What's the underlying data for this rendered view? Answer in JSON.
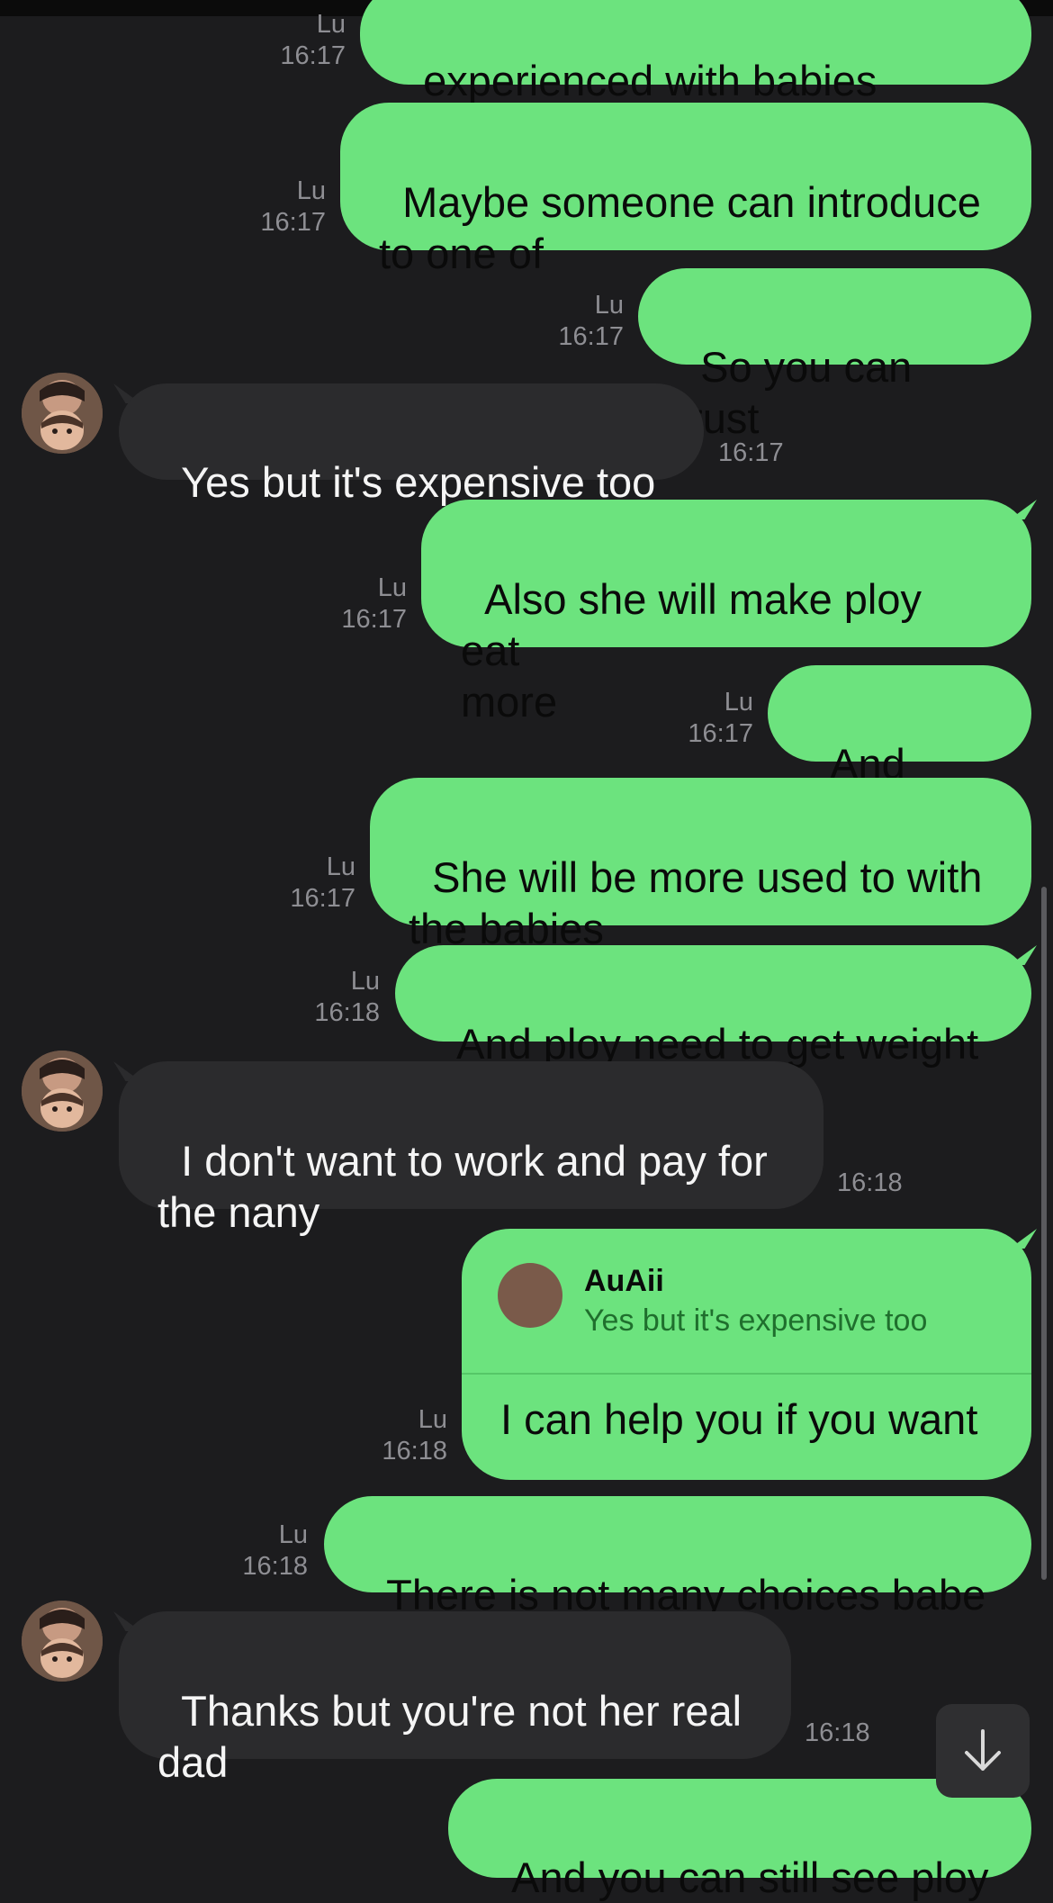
{
  "messages": [
    {
      "dir": "out",
      "sender": "Lu",
      "time": "16:17",
      "text": "experienced with babies"
    },
    {
      "dir": "out",
      "sender": "Lu",
      "time": "16:17",
      "text": "Maybe someone can introduce\nto one of"
    },
    {
      "dir": "out",
      "sender": "Lu",
      "time": "16:17",
      "text": "So you can trust"
    },
    {
      "dir": "in",
      "time": "16:17",
      "text": "Yes but it's expensive too"
    },
    {
      "dir": "out",
      "sender": "Lu",
      "time": "16:17",
      "text": "Also she will make ploy eat\nmore"
    },
    {
      "dir": "out",
      "sender": "Lu",
      "time": "16:17",
      "text": "And drink"
    },
    {
      "dir": "out",
      "sender": "Lu",
      "time": "16:17",
      "text": "She will be more used to with\nthe babies"
    },
    {
      "dir": "out",
      "sender": "Lu",
      "time": "16:18",
      "text": "And ploy need to get weight"
    },
    {
      "dir": "in",
      "time": "16:18",
      "text": "I don't want to work and pay for\nthe nany"
    },
    {
      "dir": "out",
      "sender": "Lu",
      "time": "16:18",
      "text": "I can help you if you want",
      "reply_to": {
        "name": "AuAii",
        "text": "Yes but it's expensive too"
      }
    },
    {
      "dir": "out",
      "sender": "Lu",
      "time": "16:18",
      "text": "There is not many choices babe"
    },
    {
      "dir": "in",
      "time": "16:18",
      "text": "Thanks but you're not her real\ndad"
    },
    {
      "dir": "out",
      "text": "And you can still see ploy"
    }
  ],
  "colors": {
    "background": "#1c1c1e",
    "outgoing_bubble": "#6ce37e",
    "incoming_bubble": "#2b2b2d",
    "meta_text": "#8e8e93"
  },
  "icons": {
    "jump_to_latest": "arrow-down-icon",
    "contact_avatar": "contact-avatar"
  }
}
